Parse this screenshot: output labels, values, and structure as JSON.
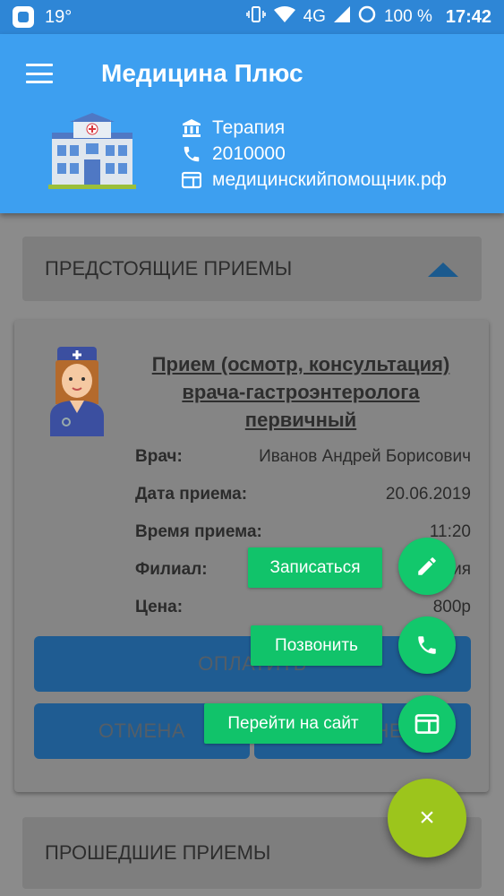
{
  "status_bar": {
    "temperature": "19°",
    "network": "4G",
    "battery": "100 %",
    "time": "17:42"
  },
  "header": {
    "title": "Медицина Плюс",
    "menu_icon": "hamburger-icon",
    "clinic_info": {
      "department": "Терапия",
      "phone": "2010000",
      "website": "медицинскийпомощник.рф"
    }
  },
  "upcoming": {
    "label": "ПРЕДСТОЯЩИЕ ПРИЕМЫ",
    "appointment": {
      "title": "Прием (осмотр, консультация) врача-гастроэнтеролога первичный",
      "details": [
        {
          "label": "Врач:",
          "value": "Иванов Андрей Борисович"
        },
        {
          "label": "Дата приема:",
          "value": "20.06.2019"
        },
        {
          "label": "Время приема:",
          "value": "11:20"
        },
        {
          "label": "Филиал:",
          "value": "Терапия"
        },
        {
          "label": "Цена:",
          "value": "800р"
        }
      ],
      "pay_button": "ОПЛАТИТЬ",
      "cancel_button": "ОТМЕНА",
      "move_button": "ПЕРЕНЕСТИ"
    }
  },
  "past": {
    "label": "ПРОШЕДШИЕ ПРИЕМЫ"
  },
  "fab_menu": {
    "items": [
      {
        "label": "Записаться",
        "icon": "pencil-icon"
      },
      {
        "label": "Позвонить",
        "icon": "phone-icon"
      },
      {
        "label": "Перейти на сайт",
        "icon": "browser-icon"
      }
    ],
    "close_icon": "×"
  },
  "colors": {
    "header": "#3d9ff0",
    "status_bar": "#2e86d6",
    "fab_mini": "#12c86c",
    "fab_main": "#9cc51c",
    "dim_overlay": "#8b8b8b"
  }
}
